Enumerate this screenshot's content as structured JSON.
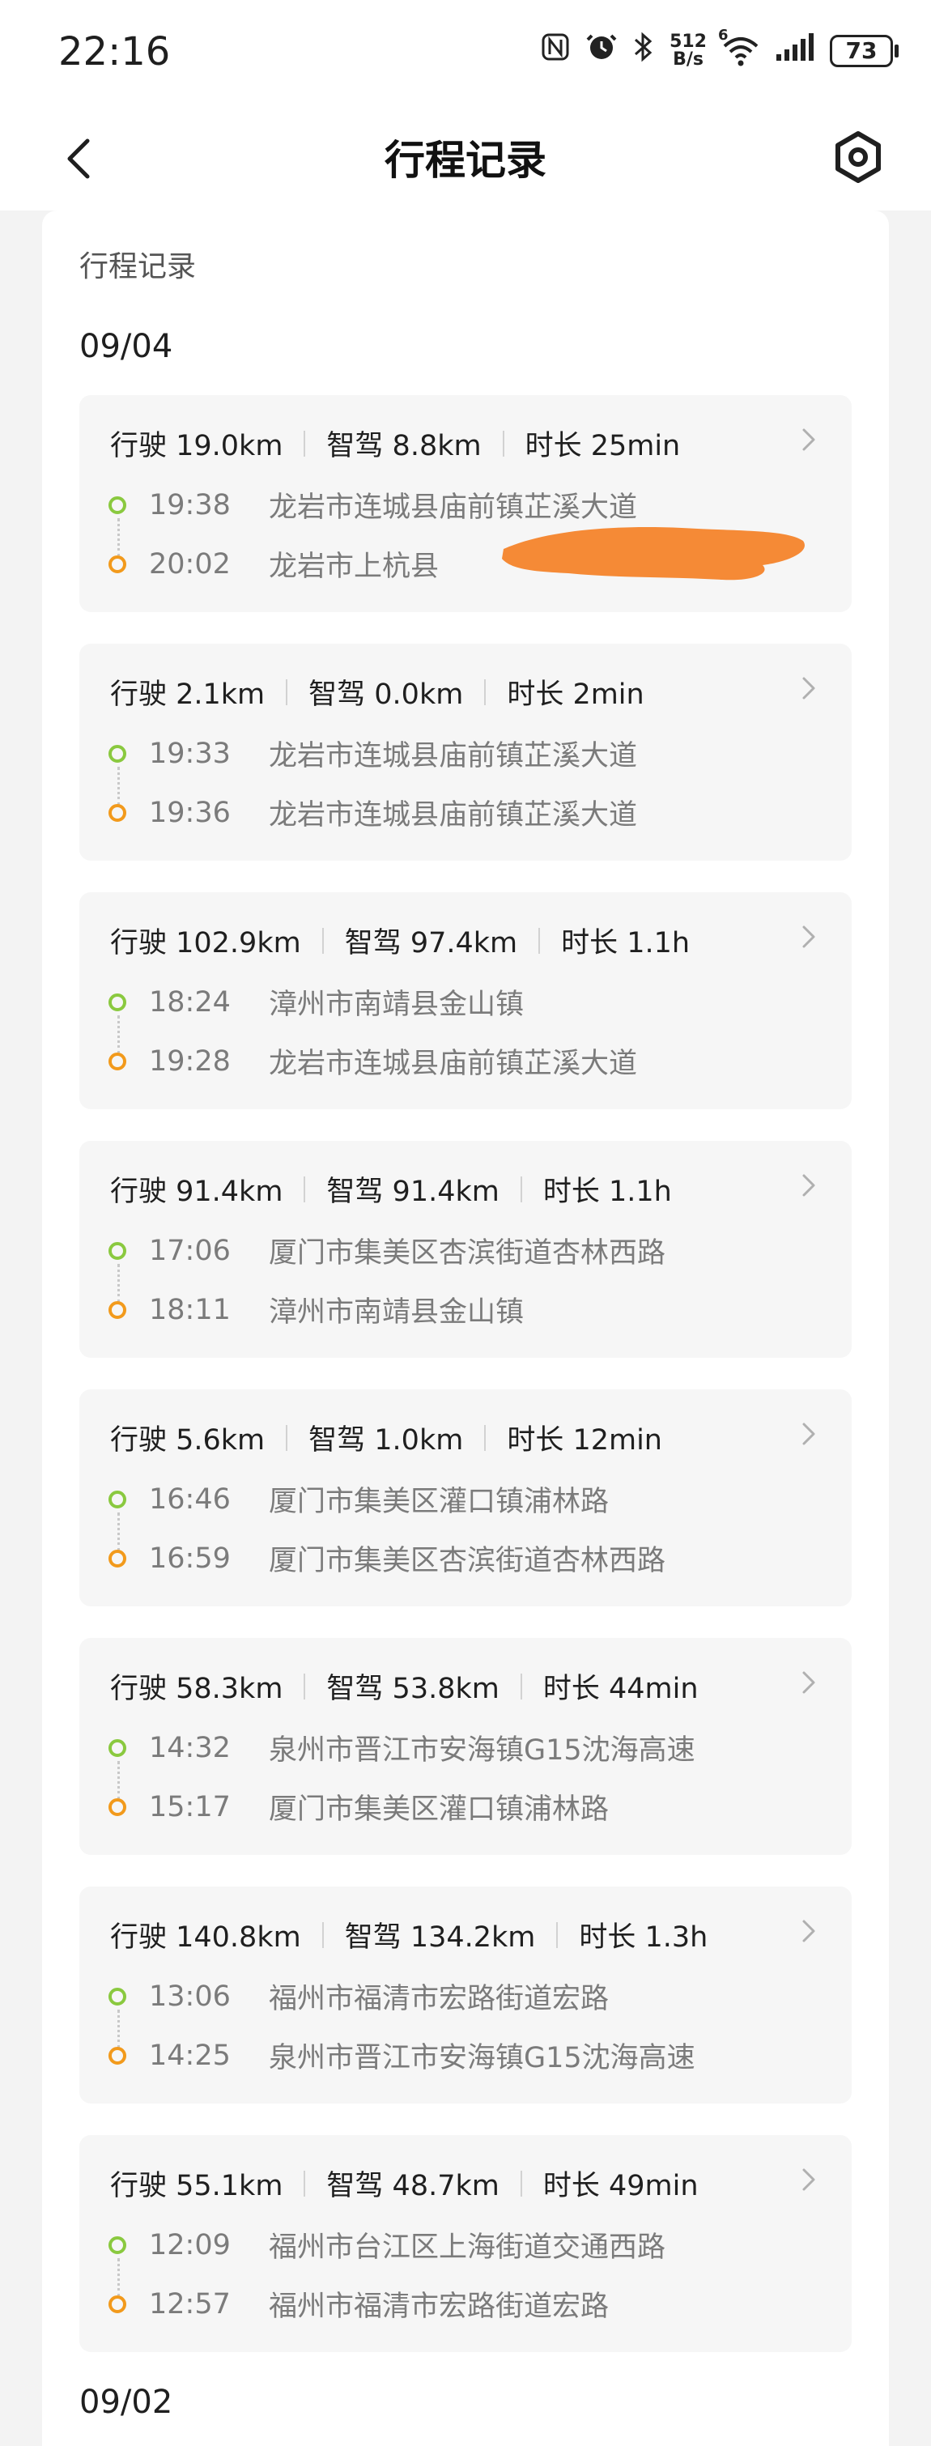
{
  "status_bar": {
    "time": "22:16",
    "net_speed_value": "512",
    "net_speed_unit": "B/s",
    "wifi_badge": "6",
    "battery": "73",
    "icons": [
      "nfc-icon",
      "alarm-icon",
      "bluetooth-icon",
      "net-speed-indicator",
      "wifi-icon",
      "signal-icon",
      "battery-icon"
    ]
  },
  "header": {
    "title": "行程记录",
    "back_icon": "chevron-left-icon",
    "settings_icon": "hexagon-settings-icon"
  },
  "section": {
    "title": "行程记录"
  },
  "colors": {
    "start_dot": "#8ac93f",
    "end_dot": "#f29a1c",
    "redaction": "#f58a36"
  },
  "groups": [
    {
      "date": "09/04",
      "trips": [
        {
          "driving": "行驶 19.0km",
          "smart": "智驾 8.8km",
          "duration": "时长 25min",
          "start_time": "19:38",
          "start_place": "龙岩市连城县庙前镇芷溪大道",
          "end_time": "20:02",
          "end_place": "龙岩市上杭县",
          "end_redacted": true
        },
        {
          "driving": "行驶 2.1km",
          "smart": "智驾 0.0km",
          "duration": "时长 2min",
          "start_time": "19:33",
          "start_place": "龙岩市连城县庙前镇芷溪大道",
          "end_time": "19:36",
          "end_place": "龙岩市连城县庙前镇芷溪大道"
        },
        {
          "driving": "行驶 102.9km",
          "smart": "智驾 97.4km",
          "duration": "时长 1.1h",
          "start_time": "18:24",
          "start_place": "漳州市南靖县金山镇",
          "end_time": "19:28",
          "end_place": "龙岩市连城县庙前镇芷溪大道"
        },
        {
          "driving": "行驶 91.4km",
          "smart": "智驾 91.4km",
          "duration": "时长 1.1h",
          "start_time": "17:06",
          "start_place": "厦门市集美区杏滨街道杏林西路",
          "end_time": "18:11",
          "end_place": "漳州市南靖县金山镇"
        },
        {
          "driving": "行驶 5.6km",
          "smart": "智驾 1.0km",
          "duration": "时长 12min",
          "start_time": "16:46",
          "start_place": "厦门市集美区灌口镇浦林路",
          "end_time": "16:59",
          "end_place": "厦门市集美区杏滨街道杏林西路"
        },
        {
          "driving": "行驶 58.3km",
          "smart": "智驾 53.8km",
          "duration": "时长 44min",
          "start_time": "14:32",
          "start_place": "泉州市晋江市安海镇G15沈海高速",
          "end_time": "15:17",
          "end_place": "厦门市集美区灌口镇浦林路"
        },
        {
          "driving": "行驶 140.8km",
          "smart": "智驾 134.2km",
          "duration": "时长 1.3h",
          "start_time": "13:06",
          "start_place": "福州市福清市宏路街道宏路",
          "end_time": "14:25",
          "end_place": "泉州市晋江市安海镇G15沈海高速"
        },
        {
          "driving": "行驶 55.1km",
          "smart": "智驾 48.7km",
          "duration": "时长 49min",
          "start_time": "12:09",
          "start_place": "福州市台江区上海街道交通西路",
          "end_time": "12:57",
          "end_place": "福州市福清市宏路街道宏路"
        }
      ]
    },
    {
      "date": "09/02",
      "trips": []
    }
  ]
}
